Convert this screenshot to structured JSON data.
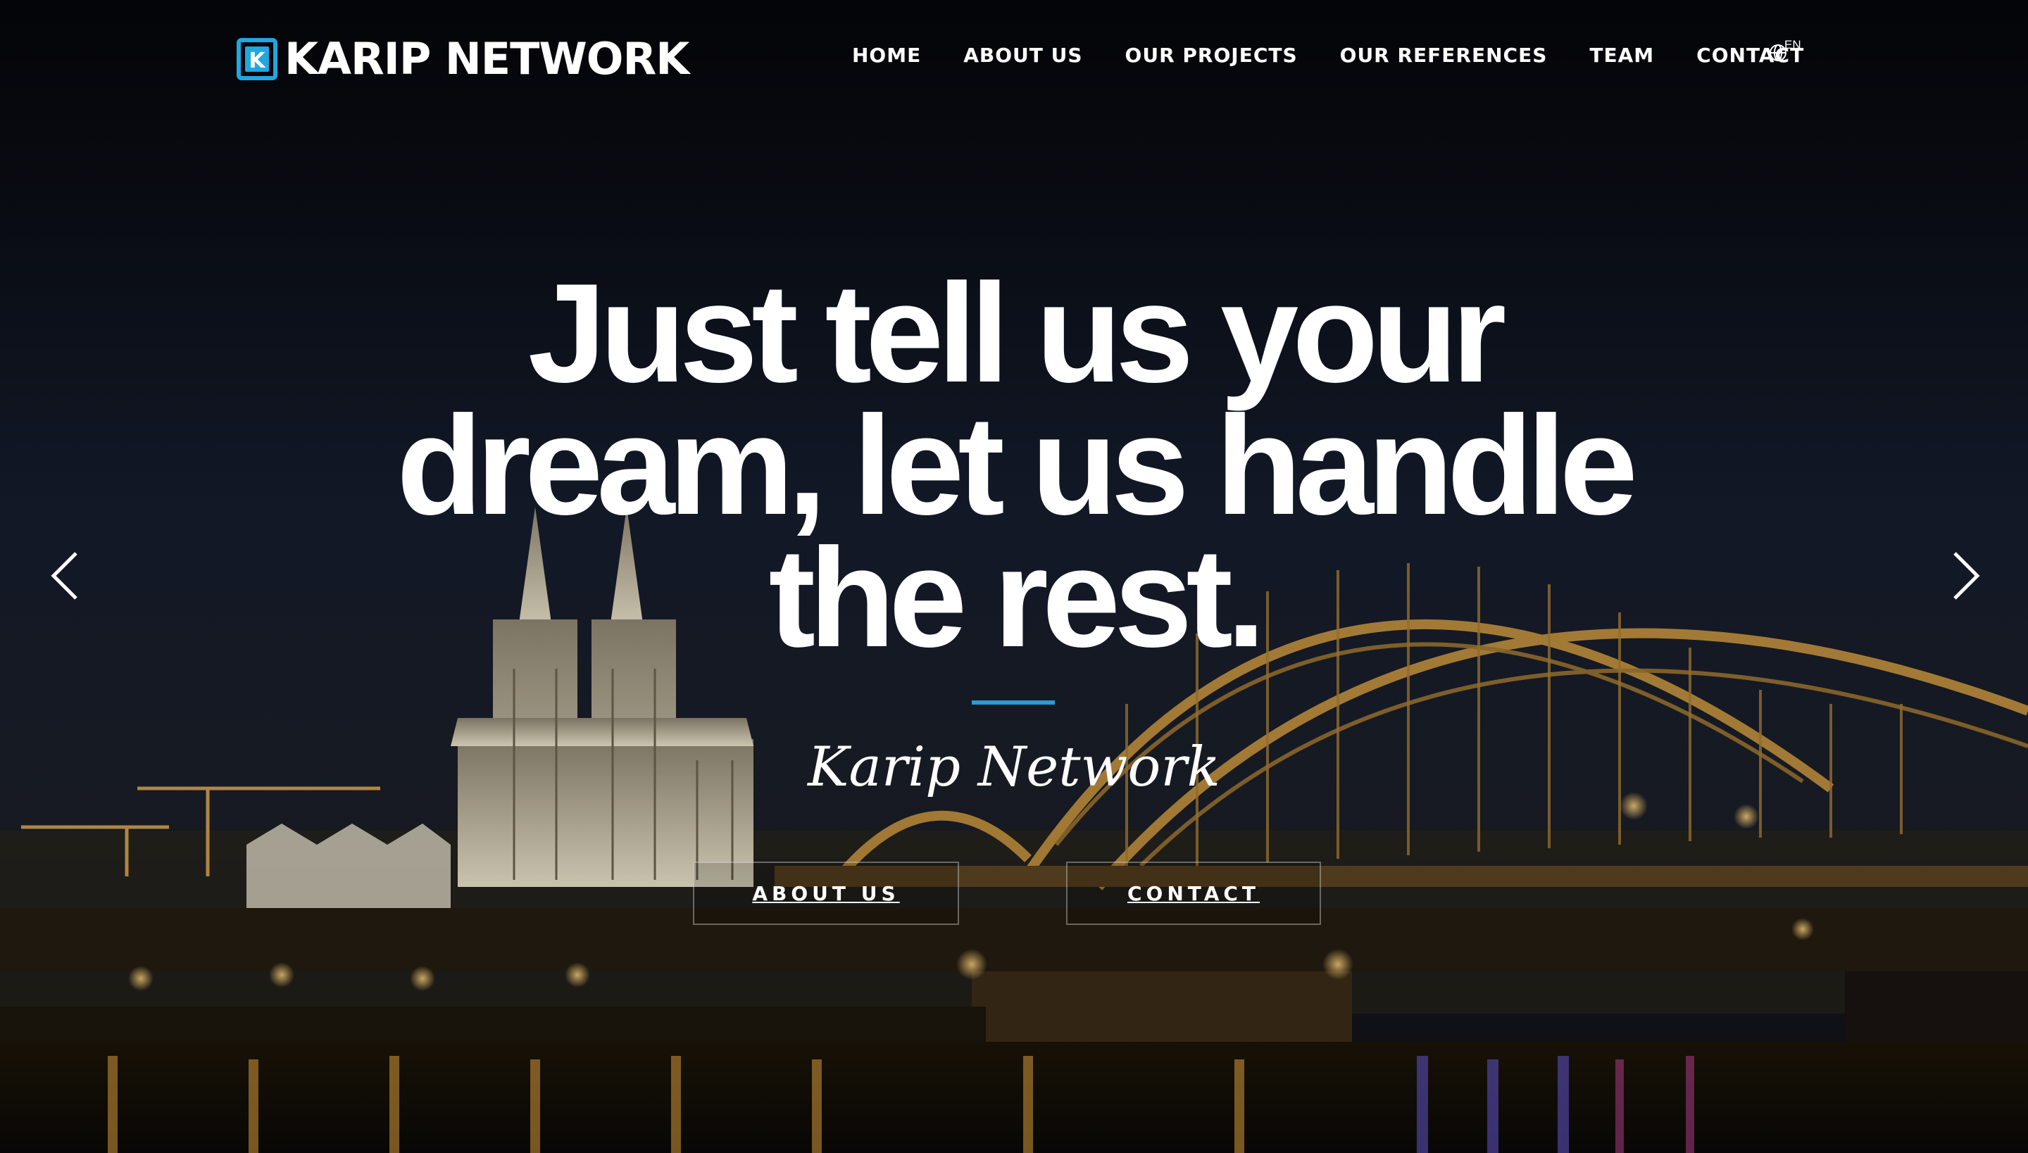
{
  "brand": {
    "name": "KARIP NETWORK",
    "logo_letter": "K",
    "accent_color": "#1fa8e0"
  },
  "nav": {
    "items": [
      {
        "label": "HOME"
      },
      {
        "label": "ABOUT US"
      },
      {
        "label": "OUR PROJECTS"
      },
      {
        "label": "OUR REFERENCES"
      },
      {
        "label": "TEAM"
      },
      {
        "label": "CONTACT"
      }
    ],
    "language": {
      "label": "EN",
      "icon": "globe-icon"
    }
  },
  "hero": {
    "headline_lines": [
      "Just tell us your",
      "dream, let us handle",
      "the rest."
    ],
    "subtitle": "Karip Network",
    "divider_color": "#2b9bd1",
    "buttons": {
      "about": "ABOUT US",
      "contact": "CONTACT"
    },
    "carousel": {
      "prev_icon": "chevron-left-icon",
      "next_icon": "chevron-right-icon"
    },
    "background": "Night view of a cathedral and an illuminated arch bridge over a river"
  }
}
